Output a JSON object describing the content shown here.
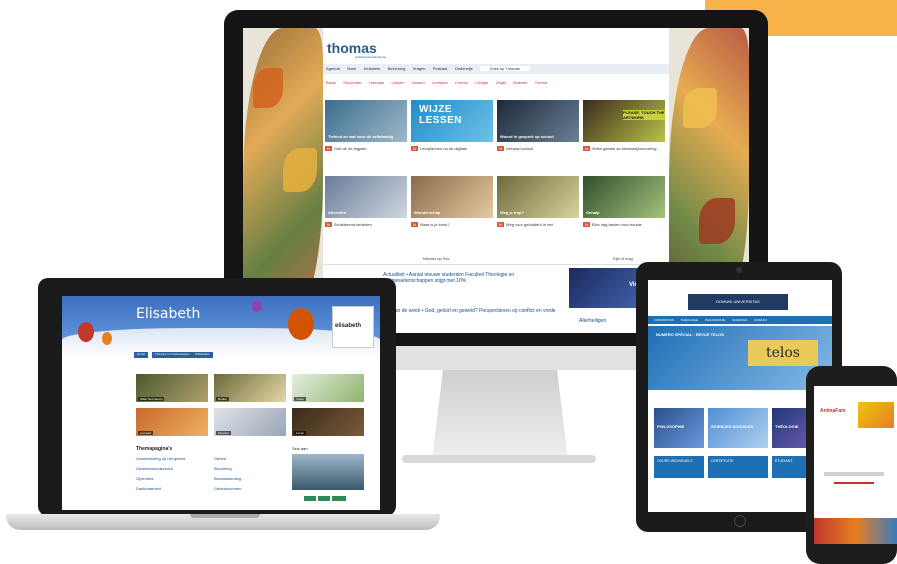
{
  "imac": {
    "site_logo": "thomas",
    "site_logo_sub": "godsdienstonderwijs.be",
    "nav": [
      "Agenda",
      "Boek",
      "Kerkwerk",
      "Bezinning",
      "Vragen",
      "Podcast",
      "Onderwijs",
      "Zoek op Thomas"
    ],
    "subnav": [
      "Basis",
      "Secundair",
      "Leerplan",
      "Lessen",
      "Lessen",
      "Leerplan",
      "Levens",
      "Liturgie",
      "Zegel",
      "Brabant",
      "Thema"
    ],
    "tiles": [
      {
        "title": "Tiefend an wat voor de zelfstandig",
        "caption": "Gott de de legplan"
      },
      {
        "title": "WIJZE LESSEN",
        "caption": "Leerplannen na de digitale"
      },
      {
        "title": "Woord in gesprek op school",
        "caption": "Leerpad school"
      },
      {
        "title": "PLEASE. TOUCH THE ARTWORK",
        "caption": "Video games as bewustzijnsvorming"
      },
      {
        "title": "Alterialen",
        "caption": "Schilderend bededen"
      },
      {
        "title": "Wonderschap",
        "caption": "Waar is je kruis?"
      },
      {
        "title": "Weg je trap?",
        "caption": "Weg voor gebuiderd in het"
      },
      {
        "title": "Gehalp",
        "caption": "Elke dag traden voor bouwe"
      }
    ],
    "bottom_links": [
      "Nieuws op Ssv",
      "Kijk of mag"
    ],
    "news_head": "Actualiteit • Aantal nieuwe studenten Faculteit Theologie en Religiewetenschappen stijgt met 10%",
    "news_head2": "Tijd van de week • God, geloof en geweld? Perspectieven op conflict en vrede",
    "side_label": "Video",
    "side_label2": "Allerheiligen"
  },
  "laptop": {
    "hero_name": "Elisabeth",
    "logo_text": "elisabeth",
    "tabs": [
      "Home",
      "Thema's en Onderwerpen",
      "Publicaties"
    ],
    "thumbs": [
      "Waar God woont",
      "Reden",
      "Vrede",
      "Leerpad",
      "Klooster",
      "Leven"
    ],
    "section_title": "Themapagina's",
    "links": [
      "Voorbereiding op het gebed",
      "Gebed",
      "Gewetensonderzoek",
      "Bezinning",
      "Openheid",
      "Bewustwording",
      "Dankbaarheid",
      "Gebedsvormen"
    ],
    "right_title": "Seiz aan"
  },
  "tablet": {
    "brand": "DOMUNI UNIVERSITAS",
    "menu": [
      "FORMATIONS",
      "THÉOLOGIE",
      "PHILOSOPHIE",
      "SCIENCES",
      "DOMUNI"
    ],
    "banner": "NUMÉRO SPÉCIAL : REVUE TELOS",
    "banner_brand": "telos",
    "tiles": [
      "PHILOSOPHIE",
      "SCIENCES SOCIALES",
      "THÉOLOGIE"
    ],
    "cards": [
      "COURS INDIVIDUELS",
      "CERTIFICATE",
      "ÉTUDIANT"
    ]
  },
  "phone": {
    "brand": "AnimaFam"
  },
  "colors": {
    "accent": "#f7b24a",
    "imac_nav": "#e8eef4",
    "laptop_hero": "#3c6fbf",
    "tablet_blue": "#1f6fb5"
  }
}
